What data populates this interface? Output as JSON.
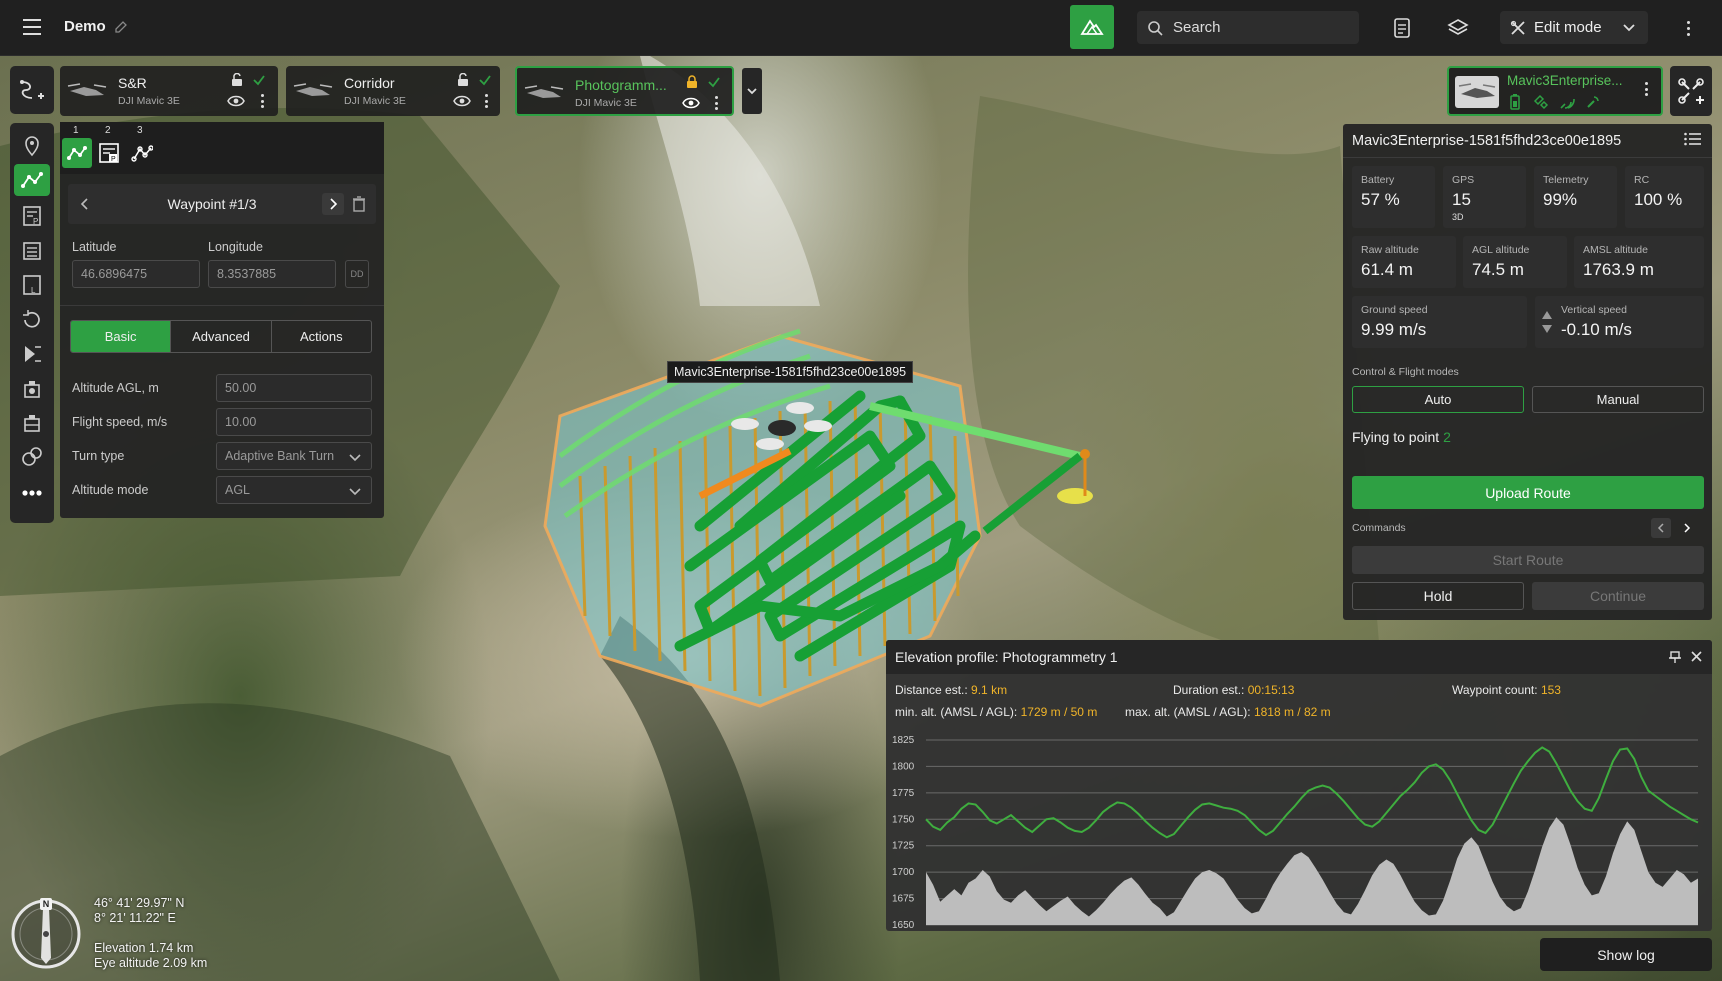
{
  "app": {
    "project_name": "Demo",
    "accent": "#2ea043",
    "warning": "#f0b429"
  },
  "topbar": {
    "search_placeholder": "Search",
    "edit_mode_label": "Edit mode",
    "icons": [
      "menu-icon",
      "pencil-icon",
      "mountain-icon",
      "search-icon",
      "clipboard-icon",
      "layers-icon",
      "tools-icon",
      "chevron-down-icon",
      "kebab-icon"
    ]
  },
  "left_toolbar": {
    "icons": [
      "add-route-icon",
      "map-pin-icon",
      "waypoint-route-icon",
      "photogrammetry-icon",
      "grid-icon",
      "facade-icon",
      "orbit-icon",
      "corridor-icon",
      "drone-photo-icon",
      "drone-grid-icon",
      "shapes-icon",
      "more-icon"
    ],
    "active_index": 2
  },
  "route_tabs": [
    {
      "name": "S&R",
      "model": "DJI Mavic 3E",
      "locked": false,
      "active": false
    },
    {
      "name": "Corridor",
      "model": "DJI Mavic 3E",
      "locked": false,
      "active": false
    },
    {
      "name": "Photogramm...",
      "model": "DJI Mavic 3E",
      "locked": true,
      "active": true
    }
  ],
  "waypoint_panel": {
    "steps": [
      "1",
      "2",
      "3"
    ],
    "title": "Waypoint #1/3",
    "latitude_label": "Latitude",
    "longitude_label": "Longitude",
    "latitude": "46.6896475",
    "longitude": "8.3537885",
    "format_button": "DD",
    "tabs": [
      "Basic",
      "Advanced",
      "Actions"
    ],
    "active_tab": "Basic",
    "params": [
      {
        "label": "Altitude AGL, m",
        "value": "50.00",
        "type": "input"
      },
      {
        "label": "Flight speed, m/s",
        "value": "10.00",
        "type": "input"
      },
      {
        "label": "Turn type",
        "value": "Adaptive Bank Turn",
        "type": "select"
      },
      {
        "label": "Altitude mode",
        "value": "AGL",
        "type": "select"
      }
    ]
  },
  "drone": {
    "header_name": "Mavic3Enterprise...",
    "full_name": "Mavic3Enterprise-1581f5fhd23ce00e1895",
    "stats": [
      {
        "label": "Battery",
        "value": "57 %"
      },
      {
        "label": "GPS",
        "value": "15",
        "sub": "3D"
      },
      {
        "label": "Telemetry",
        "value": "99%"
      },
      {
        "label": "RC",
        "value": "100 %"
      },
      {
        "label": "Raw altitude",
        "value": "61.4 m"
      },
      {
        "label": "AGL altitude",
        "value": "74.5 m"
      },
      {
        "label": "AMSL altitude",
        "value": "1763.9 m"
      },
      {
        "label": "Ground speed",
        "value": "9.99 m/s"
      },
      {
        "label": "Vertical speed",
        "value": "-0.10 m/s"
      }
    ],
    "control_label": "Control & Flight modes",
    "modes": [
      "Auto",
      "Manual"
    ],
    "active_mode": "Auto",
    "flying_text": "Flying to point",
    "flying_point": "2",
    "upload_label": "Upload Route",
    "commands_label": "Commands",
    "start_route": "Start Route",
    "hold": "Hold",
    "continue": "Continue"
  },
  "elevation": {
    "title": "Elevation profile: Photogrammetry 1",
    "distance_label": "Distance est.:",
    "distance_value": "9.1 km",
    "duration_label": "Duration est.:",
    "duration_value": "00:15:13",
    "waypoints_label": "Waypoint count:",
    "waypoints_value": "153",
    "min_label": "min. alt. (AMSL / AGL):",
    "min_value": "1729 m / 50 m",
    "max_label": "max. alt. (AMSL / AGL):",
    "max_value": "1818 m / 82 m"
  },
  "chart_data": {
    "type": "area",
    "title": "Elevation profile: Photogrammetry 1",
    "xlabel": "",
    "ylabel": "",
    "ylim": [
      1650,
      1825
    ],
    "yticks": [
      1825,
      1800,
      1775,
      1750,
      1725,
      1700,
      1675,
      1650
    ],
    "grid": true,
    "series": [
      {
        "name": "",
        "color": "#3fae3f",
        "kind": "line",
        "values": [
          1750,
          1743,
          1740,
          1747,
          1752,
          1760,
          1765,
          1764,
          1757,
          1749,
          1746,
          1750,
          1754,
          1748,
          1742,
          1738,
          1744,
          1750,
          1751,
          1747,
          1742,
          1739,
          1738,
          1742,
          1749,
          1757,
          1762,
          1766,
          1765,
          1761,
          1755,
          1748,
          1742,
          1737,
          1733,
          1736,
          1744,
          1752,
          1759,
          1764,
          1765,
          1763,
          1761,
          1760,
          1758,
          1754,
          1747,
          1740,
          1735,
          1739,
          1747,
          1755,
          1762,
          1770,
          1777,
          1780,
          1782,
          1780,
          1774,
          1767,
          1759,
          1751,
          1745,
          1743,
          1748,
          1756,
          1764,
          1772,
          1778,
          1785,
          1794,
          1800,
          1802,
          1797,
          1787,
          1774,
          1761,
          1749,
          1740,
          1737,
          1745,
          1758,
          1771,
          1784,
          1796,
          1805,
          1813,
          1818,
          1814,
          1803,
          1790,
          1777,
          1767,
          1760,
          1758,
          1770,
          1788,
          1805,
          1816,
          1817,
          1807,
          1790,
          1777,
          1772,
          1767,
          1762,
          1758,
          1754,
          1750,
          1747
        ]
      },
      {
        "name": "",
        "color": "#bdbdbd",
        "kind": "area",
        "values": [
          1700,
          1688,
          1672,
          1678,
          1684,
          1678,
          1690,
          1694,
          1702,
          1696,
          1682,
          1674,
          1671,
          1678,
          1683,
          1676,
          1669,
          1663,
          1668,
          1673,
          1677,
          1669,
          1663,
          1658,
          1664,
          1671,
          1679,
          1686,
          1692,
          1695,
          1688,
          1679,
          1671,
          1666,
          1658,
          1662,
          1673,
          1684,
          1694,
          1700,
          1702,
          1699,
          1694,
          1684,
          1674,
          1666,
          1661,
          1663,
          1675,
          1688,
          1699,
          1708,
          1716,
          1719,
          1714,
          1704,
          1693,
          1681,
          1670,
          1662,
          1660,
          1670,
          1683,
          1697,
          1707,
          1712,
          1708,
          1697,
          1684,
          1672,
          1664,
          1659,
          1660,
          1673,
          1692,
          1713,
          1727,
          1733,
          1725,
          1708,
          1691,
          1677,
          1668,
          1663,
          1666,
          1682,
          1702,
          1724,
          1742,
          1752,
          1745,
          1726,
          1704,
          1688,
          1678,
          1680,
          1696,
          1718,
          1736,
          1748,
          1740,
          1720,
          1700,
          1690,
          1686,
          1694,
          1702,
          1698,
          1690,
          1694
        ]
      }
    ]
  },
  "map_overlay": {
    "drone_label": "Mavic3Enterprise-1581f5fhd23ce00e1895",
    "lat_text": "46° 41' 29.97\" N",
    "lon_text": "8° 21' 11.22\" E",
    "elevation_text": "Elevation 1.74 km",
    "eye_text": "Eye altitude 2.09 km",
    "compass_n": "N"
  },
  "show_log_label": "Show log"
}
